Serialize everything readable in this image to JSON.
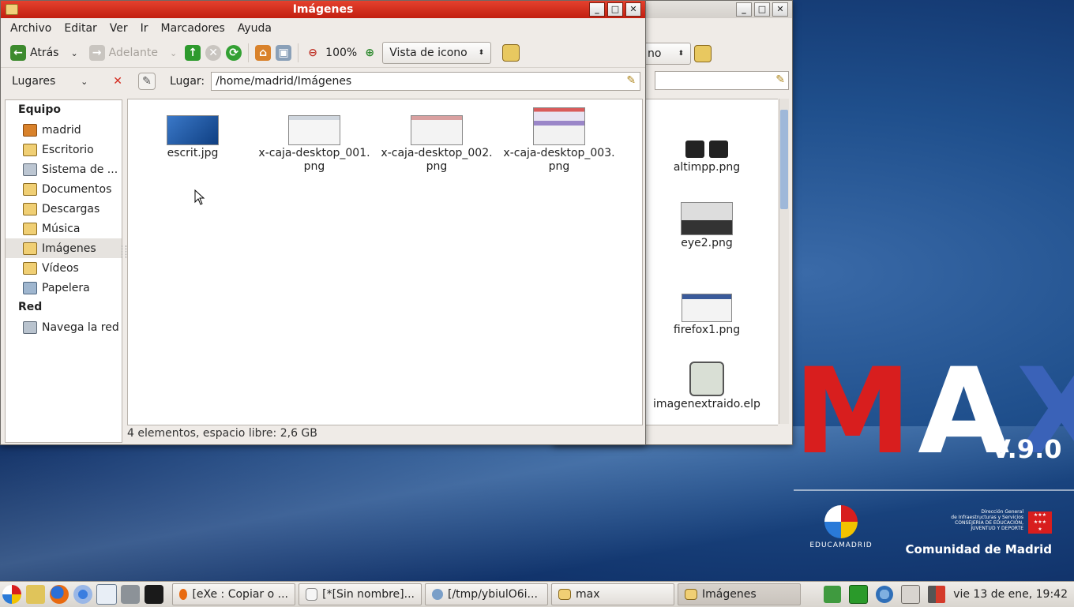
{
  "desktop": {
    "logo_letters": [
      "M",
      "A",
      "X"
    ],
    "version": "V.9.0",
    "educa_label": "EDUCAMADRID",
    "cm_small_lines": [
      "Dirección General",
      "de Infraestructuras y Servicios",
      "CONSEJERÍA DE EDUCACIÓN,",
      "JUVENTUD Y DEPORTE"
    ],
    "cm_name": "Comunidad de Madrid",
    "colors": {
      "m": "#d81e1e",
      "a": "#ffffff",
      "x": "#3a62b8"
    }
  },
  "back_window": {
    "view_combo_text": "no",
    "files": [
      {
        "name": "altimpp.png",
        "icon": "keyboard-keys-thumbnail"
      },
      {
        "name": "eye2.png",
        "icon": "screenshot-thumbnail"
      },
      {
        "name": "firefox1.png",
        "icon": "screenshot-thumbnail"
      },
      {
        "name": "imagenextraido.elp",
        "icon": "exe-package-icon"
      }
    ]
  },
  "main_window": {
    "title": "Imágenes",
    "menu": [
      "Archivo",
      "Editar",
      "Ver",
      "Ir",
      "Marcadores",
      "Ayuda"
    ],
    "toolbar": {
      "back": "Atrás",
      "forward": "Adelante",
      "zoom": "100%",
      "view_mode": "Vista de icono"
    },
    "sidebar_title": "Lugares",
    "location_label": "Lugar:",
    "location_path": "/home/madrid/Imágenes",
    "sidebar": {
      "group1": "Equipo",
      "group1_items": [
        {
          "label": "madrid",
          "icon": "home-icon"
        },
        {
          "label": "Escritorio",
          "icon": "desktop-icon"
        },
        {
          "label": "Sistema de ...",
          "icon": "drive-icon"
        },
        {
          "label": "Documentos",
          "icon": "folder-icon"
        },
        {
          "label": "Descargas",
          "icon": "folder-icon"
        },
        {
          "label": "Música",
          "icon": "music-folder-icon"
        },
        {
          "label": "Imágenes",
          "icon": "pictures-folder-icon"
        },
        {
          "label": "Vídeos",
          "icon": "videos-folder-icon"
        },
        {
          "label": "Papelera",
          "icon": "trash-icon"
        }
      ],
      "group2": "Red",
      "group2_items": [
        {
          "label": "Navega la red",
          "icon": "network-icon"
        }
      ]
    },
    "files": [
      {
        "line1": "escrit.jpg",
        "line2": ""
      },
      {
        "line1": "x-caja-desktop_001.",
        "line2": "png"
      },
      {
        "line1": "x-caja-desktop_002.",
        "line2": "png"
      },
      {
        "line1": "x-caja-desktop_003.",
        "line2": "png"
      }
    ],
    "status": "4 elementos, espacio libre: 2,6 GB"
  },
  "taskbar": {
    "tasks": [
      {
        "label": "[eXe : Copiar o ...",
        "icon": "firefox-icon"
      },
      {
        "label": "[*[Sin nombre]...",
        "icon": "text-editor-icon"
      },
      {
        "label": "[/tmp/ybiulO6i...",
        "icon": "exe-icon"
      },
      {
        "label": "max",
        "icon": "folder-icon"
      },
      {
        "label": "Imágenes",
        "icon": "folder-icon"
      }
    ],
    "clock": "vie 13 de ene, 19:42"
  }
}
